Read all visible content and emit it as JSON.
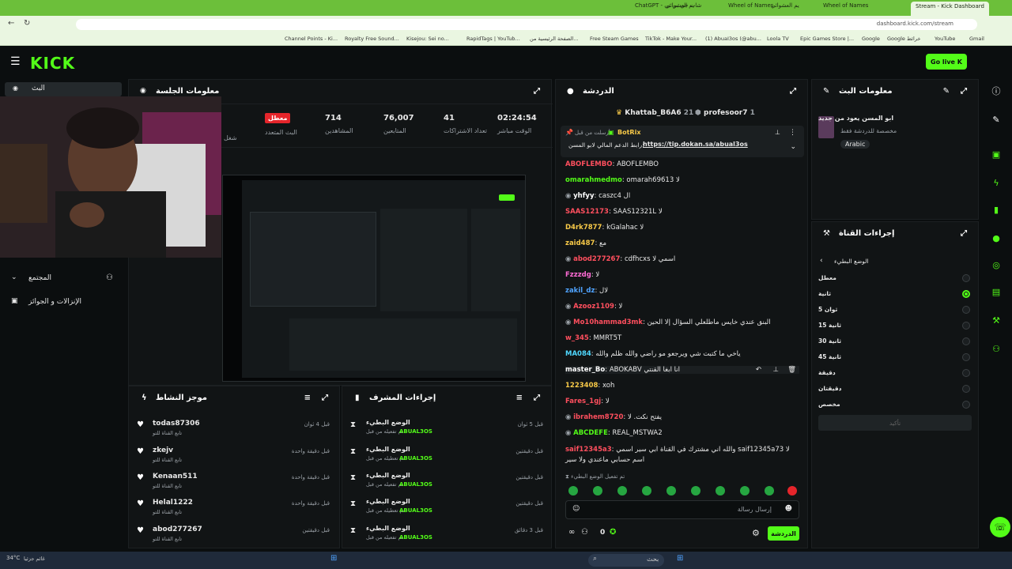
{
  "browser": {
    "tabs": [
      "ChatGPT - شات جي بي تي",
      "يم العشوائي",
      "Wheel of Names",
      "يم العشوائي",
      "Wheel of Names",
      "Stream - Kick Dashboard"
    ],
    "url": "dashboard.kick.com/stream",
    "bookmarks": [
      "Channel Points - Ki...",
      "Royalty Free Sound...",
      "Kisejou: Sei no...",
      "RapidTags | YouTub...",
      "الصفحة الرئيسية من...",
      "Free Steam Games",
      "TikTok - Make Your...",
      "(1) AbuaI3os (@abu...",
      "Loola TV",
      "Epic Games Store |...",
      "Google",
      "Google خرائط",
      "YouTube",
      "Gmail"
    ]
  },
  "header": {
    "logo": "KICK",
    "go_live": "Go live"
  },
  "session": {
    "title": "معلومات الجلسة",
    "stats": [
      {
        "value": "02:24:54",
        "label": "الوقت مباشر"
      },
      {
        "value": "41",
        "label": "تعداد الاشتراكات"
      },
      {
        "value": "76,007",
        "label": "المتابعين"
      },
      {
        "value": "714",
        "label": "المشاهدين"
      },
      {
        "value": "معطل",
        "label": "البث المتعدد"
      }
    ],
    "partial_label": "شغل"
  },
  "left_nav": {
    "live": "البث",
    "community": "المجتمع",
    "drops": "الإنزالات و الجوائز"
  },
  "chat": {
    "title": "الدردشة",
    "top_users": [
      {
        "name": "Khattab_B6A6",
        "count": "21"
      },
      {
        "name": "profesoor7",
        "count": "1"
      }
    ],
    "pinned": {
      "by": "أرسلت من قبل",
      "bot": "BotRix",
      "text": "رابط الدعم المالي لابو المسن:",
      "link": "https://tip.dokan.sa/abual3os"
    },
    "messages": [
      {
        "user": "ABOFLEMBO",
        "text": "ABOFLEMBO",
        "color": "#ff4f5e"
      },
      {
        "user": "omarahmedmo",
        "text": "omarah69613 لا",
        "color": "#53fc18"
      },
      {
        "user": "yhfyy",
        "text": "caszc4 ال",
        "color": "#ffffff"
      },
      {
        "user": "SAAS12173",
        "text": "SAAS12321L لا",
        "color": "#ff4f5e"
      },
      {
        "user": "D4rk7877",
        "text": "kGalahac لا",
        "color": "#f7c948"
      },
      {
        "user": "zaid487",
        "text": "مع",
        "color": "#f7c948"
      },
      {
        "user": "abod277267",
        "text": "cdfhcxs اسمي لا",
        "color": "#ff4f5e"
      },
      {
        "user": "Fzzzdg",
        "text": "لا",
        "color": "#ff6bd5"
      },
      {
        "user": "zakil_dz",
        "text": "لال",
        "color": "#4fa3ff"
      },
      {
        "user": "Azooz1109",
        "text": "لا",
        "color": "#ff4f5e"
      },
      {
        "user": "Mo10hammad3mk",
        "text": "البنق عندي خايس ماطلعلي السؤال إلا الحين",
        "color": "#ff4f5e"
      },
      {
        "user": "w_345",
        "text": "MMRT5T",
        "color": "#ff4f5e"
      },
      {
        "user": "MA084",
        "text": "ياخي ما كتبت شي ويرجعو مو راضي والله ظلم والله",
        "color": "#4fd8ff"
      },
      {
        "user": "master_Bo",
        "text": "ABOKABV انا ابغا القنتي",
        "color": "#ffffff"
      },
      {
        "user": "1223408",
        "text": "xoh",
        "color": "#f7c948"
      },
      {
        "user": "Fares_1gj",
        "text": "لا",
        "color": "#ff4f5e"
      },
      {
        "user": "ibrahem8720",
        "text": "يفتح نكت. لا",
        "color": "#ff4f5e"
      },
      {
        "user": "ABCDEFE",
        "text": "REAL_MSTWA2",
        "color": "#53fc18"
      },
      {
        "user": "saif12345a3",
        "text": "والله اني مشترك في القناة ابي سير اسمي saif12345a73 لا اسم حسابي ماعندي ولا سير",
        "color": "#ff4f5e"
      }
    ],
    "slow_mode_note": "تم تفعيل الوضع البطيء",
    "input_placeholder": "إرسال رسالة",
    "send_label": "الدردشة",
    "points": "0"
  },
  "stream_info": {
    "title": "معلومات البث",
    "stream_title": "ابو المسن يعود من جديد",
    "category": "مخصصة للدردشة فقط",
    "language": "Arabic"
  },
  "channel_actions": {
    "title": "إجراءات القناة",
    "slow_mode_title": "الوضع البطيء",
    "options": [
      "معطل",
      "ثانية",
      "ثوان 5",
      "ثانية 15",
      "ثانية 30",
      "ثانية 45",
      "دقيقة",
      "دقيقتان",
      "مخصص"
    ],
    "selected_index": 1,
    "confirm_label": "تأكيد"
  },
  "activity": {
    "title": "موجز النشاط",
    "items": [
      {
        "user": "todas87306",
        "desc": "تابع القناة للتو",
        "time": "قبل 4 ثوان"
      },
      {
        "user": "zkejv",
        "desc": "تابع القناة للتو",
        "time": "قبل دقيقة واحدة"
      },
      {
        "user": "Kenaan511",
        "desc": "تابع القناة للتو",
        "time": "قبل دقيقة واحدة"
      },
      {
        "user": "Helal1222",
        "desc": "تابع القناة للتو",
        "time": "قبل دقيقة واحدة"
      },
      {
        "user": "abod277267",
        "desc": "تابع القناة للتو",
        "time": "قبل دقيقتين"
      }
    ]
  },
  "mod_actions": {
    "title": "إجراءات المشرف",
    "items": [
      {
        "action": "الوضع البطيء",
        "desc": "تم تفعيله من قبل",
        "by": "ABUAL3OS",
        "time": "قبل 5 ثوان"
      },
      {
        "action": "الوضع البطيء",
        "desc": "تم تعطيله من قبل",
        "by": "ABUAL3OS",
        "time": "قبل دقيقتين"
      },
      {
        "action": "الوضع البطيء",
        "desc": "تم تفعيله من قبل",
        "by": "ABUAL3OS",
        "time": "قبل دقيقتين"
      },
      {
        "action": "الوضع البطيء",
        "desc": "تم تعطيله من قبل",
        "by": "ABUAL3OS",
        "time": "قبل دقيقتين"
      },
      {
        "action": "الوضع البطيء",
        "desc": "تم تفعيله من قبل",
        "by": "ABUAL3OS",
        "time": "قبل 3 دقائق"
      }
    ]
  },
  "taskbar": {
    "search": "بحث",
    "time": "34°C",
    "date": "غائم جزئيا"
  },
  "colors": {
    "accent": "#53fc18",
    "panel": "#111415",
    "bg": "#0b0e0f",
    "browser": "#6cbf3a"
  }
}
